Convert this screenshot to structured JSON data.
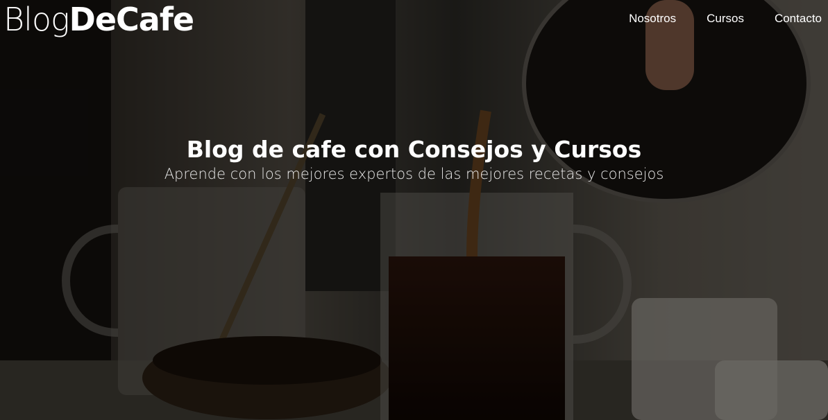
{
  "header": {
    "logo_part1": "Blog",
    "logo_part2": "DeCafe",
    "nav": [
      {
        "label": "Nosotros"
      },
      {
        "label": "Cursos"
      },
      {
        "label": "Contacto"
      }
    ]
  },
  "hero": {
    "title": "Blog de cafe con Consejos y Cursos",
    "subtitle": "Aprende con los mejores expertos de las mejores recetas y consejos"
  },
  "colors": {
    "text": "#ffffff",
    "overlay": "rgba(0,0,0,0.55)"
  }
}
